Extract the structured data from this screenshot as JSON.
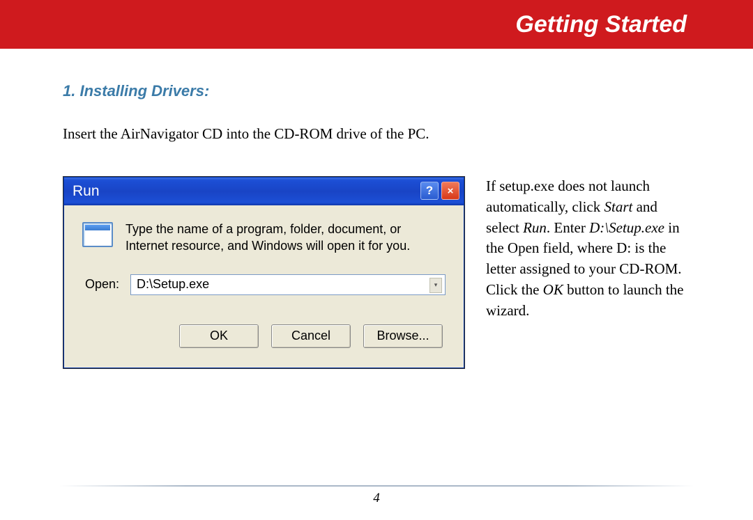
{
  "header": {
    "title": "Getting Started"
  },
  "section": {
    "heading": "1. Installing Drivers:",
    "intro": "Insert the AirNavigator CD into the CD-ROM drive of the PC."
  },
  "dialog": {
    "title": "Run",
    "help_symbol": "?",
    "close_symbol": "×",
    "message": "Type the name of a program, folder, document, or Internet resource, and Windows will open it for you.",
    "open_label": "Open:",
    "open_value": "D:\\Setup.exe",
    "dropdown_arrow": "▾",
    "buttons": {
      "ok": "OK",
      "cancel": "Cancel",
      "browse": "Browse..."
    }
  },
  "side": {
    "p1a": "If setup.exe does not launch automatically, click ",
    "p1b_italic": "Start",
    "p1c": " and select ",
    "p1d_italic": "Run",
    "p1e": ".  Enter ",
    "p1f_italic": "D:\\Setup.exe",
    "p1g": " in the Open field, where D: is the letter assigned to your CD-ROM. Click the ",
    "p1h_italic": "OK",
    "p1i": " button to launch the wizard."
  },
  "footer": {
    "page": "4"
  }
}
